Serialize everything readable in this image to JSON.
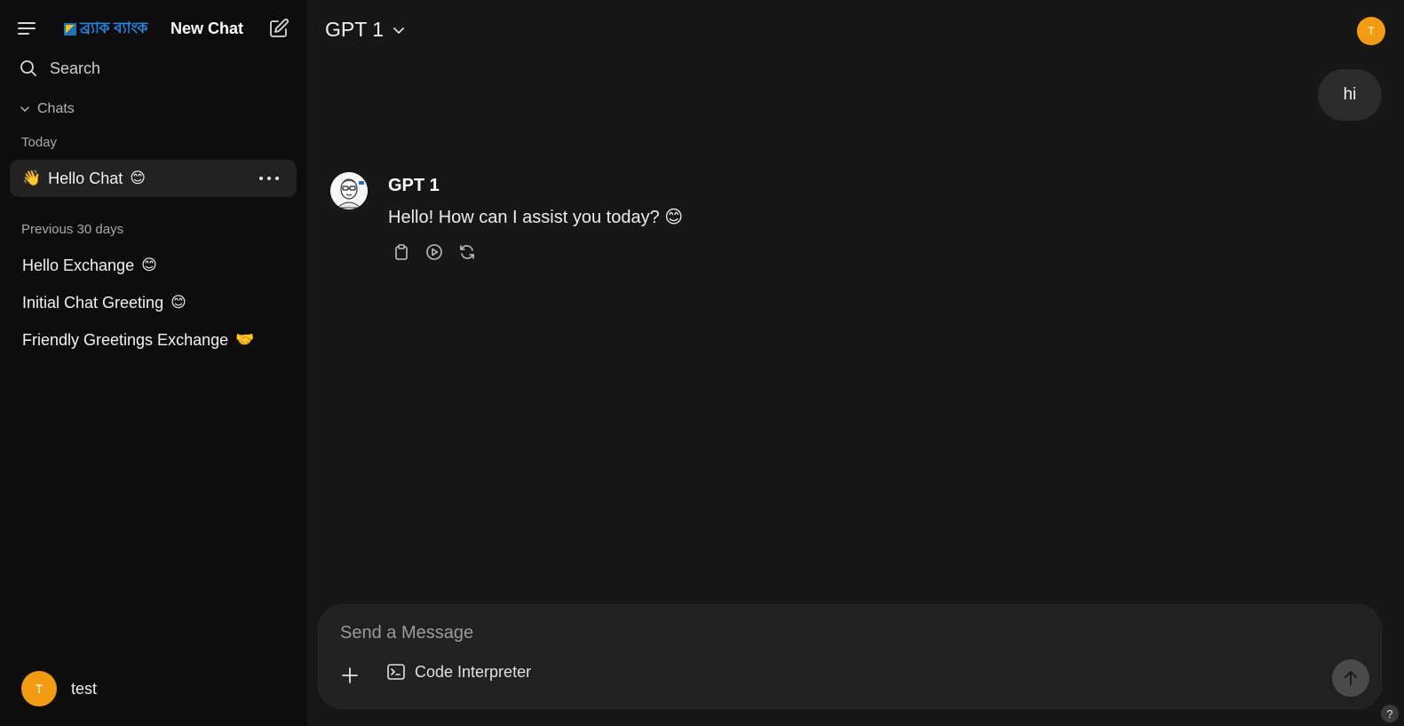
{
  "sidebar": {
    "brand_text": "ব্র্যাক ব্যাংক",
    "new_chat_label": "New Chat",
    "search_label": "Search",
    "chats_section_label": "Chats",
    "groups": {
      "today_label": "Today",
      "prev30_label": "Previous 30 days"
    },
    "today_items": [
      {
        "pre_emoji": "👋",
        "label": "Hello Chat",
        "emoji": "😊"
      }
    ],
    "prev30_items": [
      {
        "label": "Hello Exchange",
        "emoji": "😊"
      },
      {
        "label": "Initial Chat Greeting",
        "emoji": "😊"
      },
      {
        "label": "Friendly Greetings Exchange",
        "emoji": "🤝"
      }
    ],
    "user": {
      "initial": "T",
      "name": "test"
    }
  },
  "header": {
    "model_name": "GPT 1",
    "avatar_initial": "T"
  },
  "conversation": {
    "user_message": "hi",
    "assistant_name": "GPT 1",
    "assistant_message": "Hello! How can I assist you today? 😊"
  },
  "composer": {
    "placeholder": "Send a Message",
    "value": "",
    "code_interpreter_label": "Code Interpreter"
  },
  "help_label": "?",
  "colors": {
    "sidebar_bg": "#0d0d0d",
    "main_bg": "#171717",
    "avatar_orange": "#f39c12",
    "brand_blue": "#1e88e5"
  }
}
